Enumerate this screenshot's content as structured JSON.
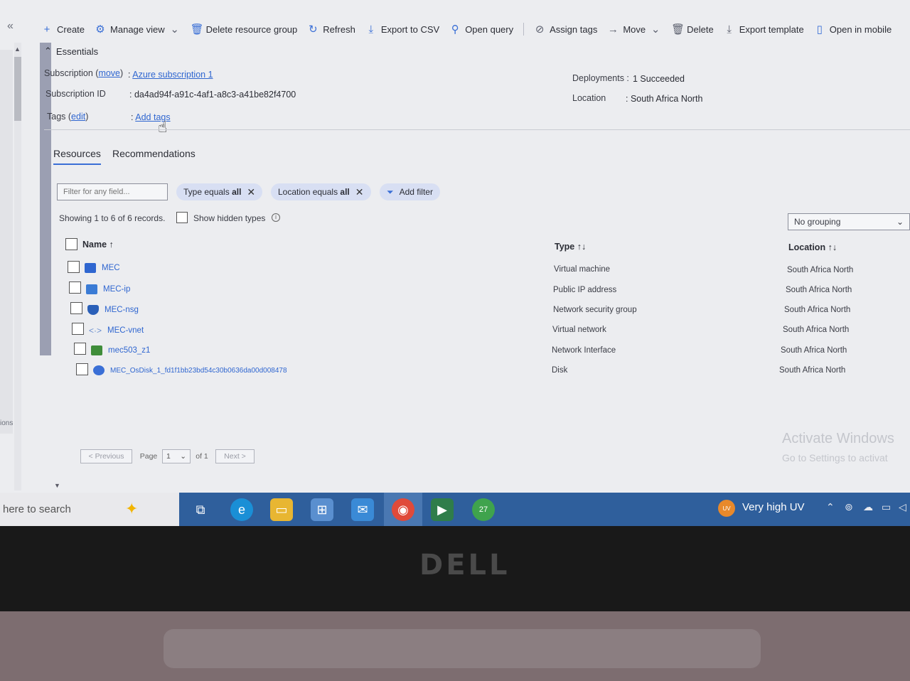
{
  "command_bar": {
    "collapse": "«",
    "create": "Create",
    "manage_view": "Manage view",
    "delete_rg": "Delete resource group",
    "refresh": "Refresh",
    "export_csv": "Export to CSV",
    "open_query": "Open query",
    "assign_tags": "Assign tags",
    "move": "Move",
    "delete": "Delete",
    "export_template": "Export template",
    "open_mobile": "Open in mobile"
  },
  "essentials": {
    "title": "Essentials",
    "subscription_label": "Subscription",
    "subscription_move": "move",
    "subscription_value": "Azure subscription 1",
    "subscription_id_label": "Subscription ID",
    "subscription_id_value": "da4ad94f-a91c-4af1-a8c3-a41be82f4700",
    "tags_label": "Tags",
    "tags_edit": "edit",
    "tags_value": "Add tags",
    "deployments_label": "Deployments",
    "deployments_value": "1 Succeeded",
    "location_label": "Location",
    "location_value": "South Africa North"
  },
  "tabs": [
    "Resources",
    "Recommendations"
  ],
  "filters": {
    "placeholder": "Filter for any field...",
    "type_prefix": "Type equals",
    "type_value": "all",
    "location_prefix": "Location equals",
    "location_value": "all",
    "add_filter": "Add filter"
  },
  "records": {
    "showing": "Showing 1 to 6 of 6 records.",
    "show_hidden": "Show hidden types",
    "grouping": "No grouping"
  },
  "table": {
    "headers": {
      "name": "Name",
      "type": "Type",
      "location": "Location"
    },
    "rows": [
      {
        "name": "MEC",
        "type": "Virtual machine",
        "location": "South Africa North",
        "icon_color": "#2f66d0",
        "icon": "vm-icon"
      },
      {
        "name": "MEC-ip",
        "type": "Public IP address",
        "location": "South Africa North",
        "icon_color": "#3a7bd5",
        "icon": "public-ip-icon"
      },
      {
        "name": "MEC-nsg",
        "type": "Network security group",
        "location": "South Africa North",
        "icon_color": "#2a5fb8",
        "icon": "shield-icon"
      },
      {
        "name": "MEC-vnet",
        "type": "Virtual network",
        "location": "South Africa North",
        "icon_color": "#6b8fcf",
        "icon": "vnet-icon"
      },
      {
        "name": "mec503_z1",
        "type": "Network Interface",
        "location": "South Africa North",
        "icon_color": "#3f8d3a",
        "icon": "nic-icon"
      },
      {
        "name": "MEC_OsDisk_1_fd1f1bb23bd54c30b0636da00d008478",
        "type": "Disk",
        "location": "South Africa North",
        "icon_color": "#3a6fd6",
        "icon": "disk-icon"
      }
    ]
  },
  "pager": {
    "previous": "< Previous",
    "page_label": "Page",
    "page_value": "1",
    "of": "of 1",
    "next": "Next >"
  },
  "left_label": "ions",
  "watermark": {
    "line1": "Activate Windows",
    "line2": "Go to Settings to activat"
  },
  "taskbar": {
    "search": "here to search",
    "uv_badge": "UV",
    "uv_text": "Very high UV",
    "whatsapp_badge": "27"
  },
  "bezel": {
    "logo": "DELL"
  }
}
